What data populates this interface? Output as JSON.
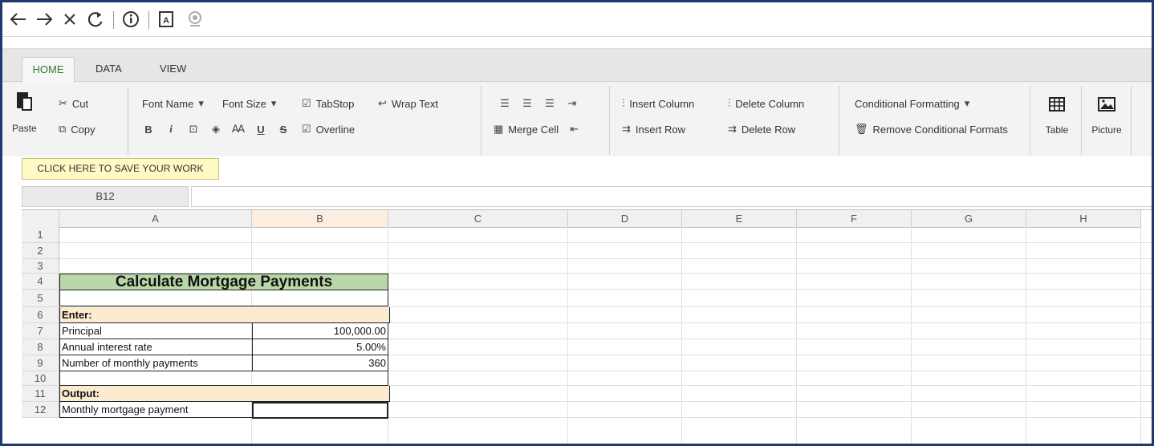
{
  "toolbar": {
    "back_icon": "arrow-left-icon",
    "forward_icon": "arrow-right-icon",
    "close_icon": "close-icon",
    "refresh_icon": "refresh-icon",
    "info_icon": "info-icon",
    "reader_icon": "document-icon",
    "camera_icon": "webcam-icon"
  },
  "tabs": [
    "HOME",
    "DATA",
    "VIEW"
  ],
  "ribbon": {
    "paste": "Paste",
    "cut": "Cut",
    "copy": "Copy",
    "font_name": "Font Name",
    "font_size": "Font Size",
    "tabstop": "TabStop",
    "wrap_text": "Wrap Text",
    "overline": "Overline",
    "merge_cell": "Merge Cell",
    "insert_column": "Insert Column",
    "delete_column": "Delete Column",
    "insert_row": "Insert Row",
    "delete_row": "Delete Row",
    "conditional_formatting": "Conditional Formatting",
    "remove_conditional": "Remove Conditional Formats",
    "table": "Table",
    "picture": "Picture"
  },
  "save_banner": "CLICK HERE TO SAVE YOUR WORK",
  "name_box": "B12",
  "formula_value": "",
  "columns": [
    "A",
    "B",
    "C",
    "D",
    "E",
    "F",
    "G",
    "H"
  ],
  "rows": [
    "1",
    "2",
    "3",
    "4",
    "5",
    "6",
    "7",
    "8",
    "9",
    "10",
    "11",
    "12"
  ],
  "sheet": {
    "title": "Calculate Mortgage Payments",
    "enter_label": "Enter:",
    "principal_label": "Principal",
    "principal_value": "100,000.00",
    "rate_label": "Annual interest rate",
    "rate_value": "5.00%",
    "payments_label": "Number of monthly payments",
    "payments_value": "360",
    "output_label": "Output:",
    "monthly_label": "Monthly mortgage payment",
    "monthly_value": ""
  },
  "colors": {
    "title_fill": "#b9d7a8",
    "section_fill": "#fdebd0",
    "active_tab": "#2e7d32",
    "frame": "#1f3a6e"
  }
}
